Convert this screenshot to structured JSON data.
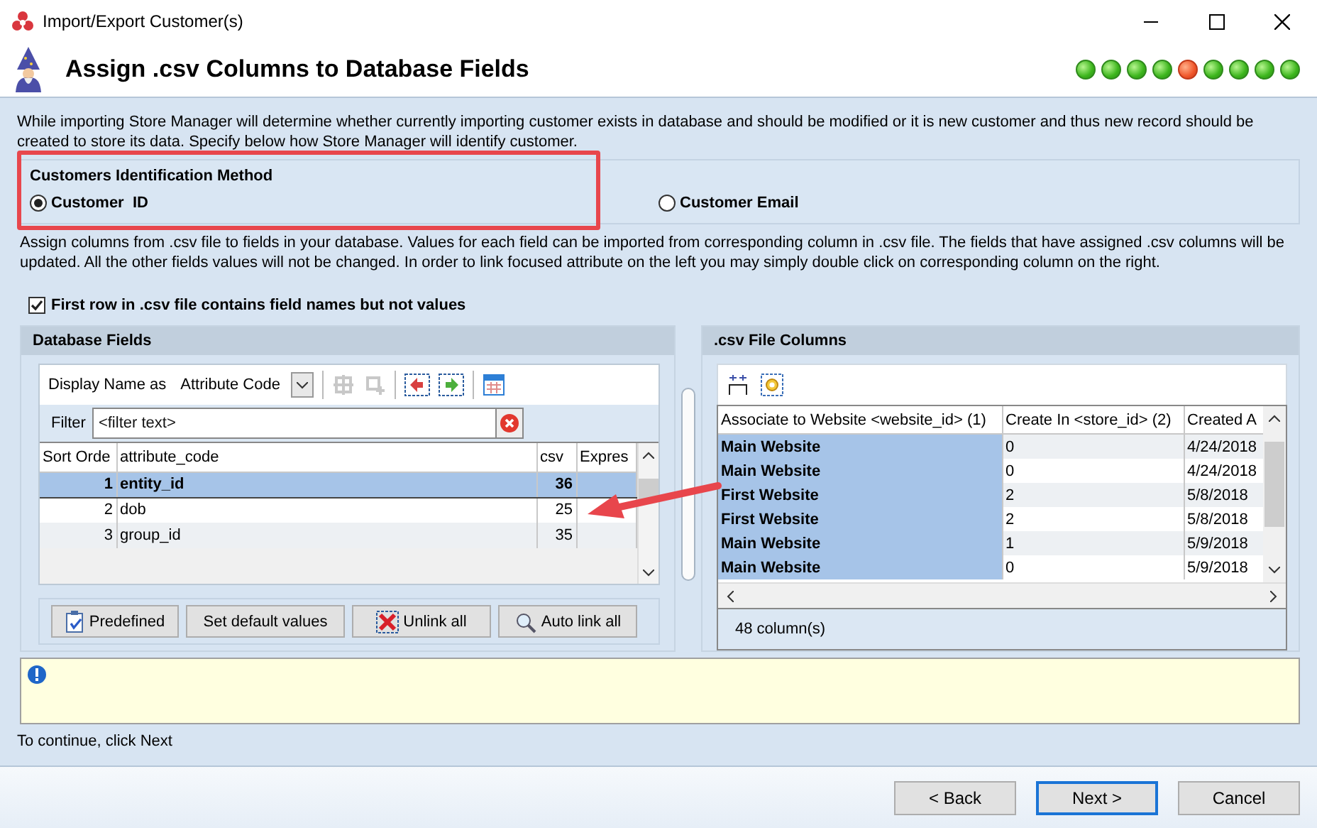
{
  "window": {
    "title": "Import/Export Customer(s)"
  },
  "header": {
    "title": "Assign .csv Columns to Database Fields",
    "steps": [
      {
        "selected": false
      },
      {
        "selected": false
      },
      {
        "selected": false
      },
      {
        "selected": false
      },
      {
        "selected": true
      },
      {
        "selected": false
      },
      {
        "selected": false
      },
      {
        "selected": false
      },
      {
        "selected": false
      }
    ]
  },
  "intro": "While importing Store Manager will determine whether currently importing customer exists in database and should be modified or it is new customer and thus new record should be created to store its data. Specify below how Store Manager will identify customer.",
  "identification": {
    "title": "Customers Identification Method",
    "options": [
      {
        "label": "Customer  ID",
        "selected": true
      },
      {
        "label": "Customer Email",
        "selected": false
      }
    ]
  },
  "assign_note": "Assign columns from .csv file to fields in your database. Values for each field can be imported from corresponding column in .csv file. The fields that have assigned .csv columns will be updated. All the other fields values will not be changed. In order to link focused attribute on the left you may simply double click on corresponding column on the right.",
  "first_row_option": {
    "label": "First row in .csv file contains field names but not values",
    "checked": true
  },
  "database_fields": {
    "title": "Database Fields",
    "display_name_label": "Display Name as",
    "display_name_value": "Attribute Code",
    "filter_label": "Filter",
    "filter_placeholder": "<filter text>",
    "columns": [
      "Sort Orde",
      "attribute_code",
      "csv",
      "Expres"
    ],
    "rows": [
      {
        "sort_order": "1",
        "attribute_code": "entity_id",
        "csv": "36",
        "selected": true
      },
      {
        "sort_order": "2",
        "attribute_code": "dob",
        "csv": "25",
        "selected": false
      },
      {
        "sort_order": "3",
        "attribute_code": "group_id",
        "csv": "35",
        "selected": false
      }
    ],
    "buttons": [
      "Predefined",
      "Set default values",
      "Unlink all",
      "Auto link all"
    ]
  },
  "csv_columns": {
    "title": ".csv File Columns",
    "columns": [
      {
        "label": "Associate to Website <website_id> (1)",
        "selected": true
      },
      {
        "label": "Create In <store_id> (2)",
        "selected": false
      },
      {
        "label": "Created A",
        "selected": false
      }
    ],
    "rows": [
      [
        "Main Website",
        "0",
        "4/24/2018"
      ],
      [
        "Main Website",
        "0",
        "4/24/2018"
      ],
      [
        "First Website",
        "2",
        "5/8/2018"
      ],
      [
        "First Website",
        "2",
        "5/8/2018"
      ],
      [
        "Main Website",
        "1",
        "5/9/2018"
      ],
      [
        "Main Website",
        "0",
        "5/9/2018"
      ]
    ],
    "status": "48 column(s)"
  },
  "hint": "To continue, click Next",
  "buttons": [
    {
      "label": "< Back",
      "default": false
    },
    {
      "label": "Next >",
      "default": true
    },
    {
      "label": "Cancel",
      "default": false
    }
  ]
}
